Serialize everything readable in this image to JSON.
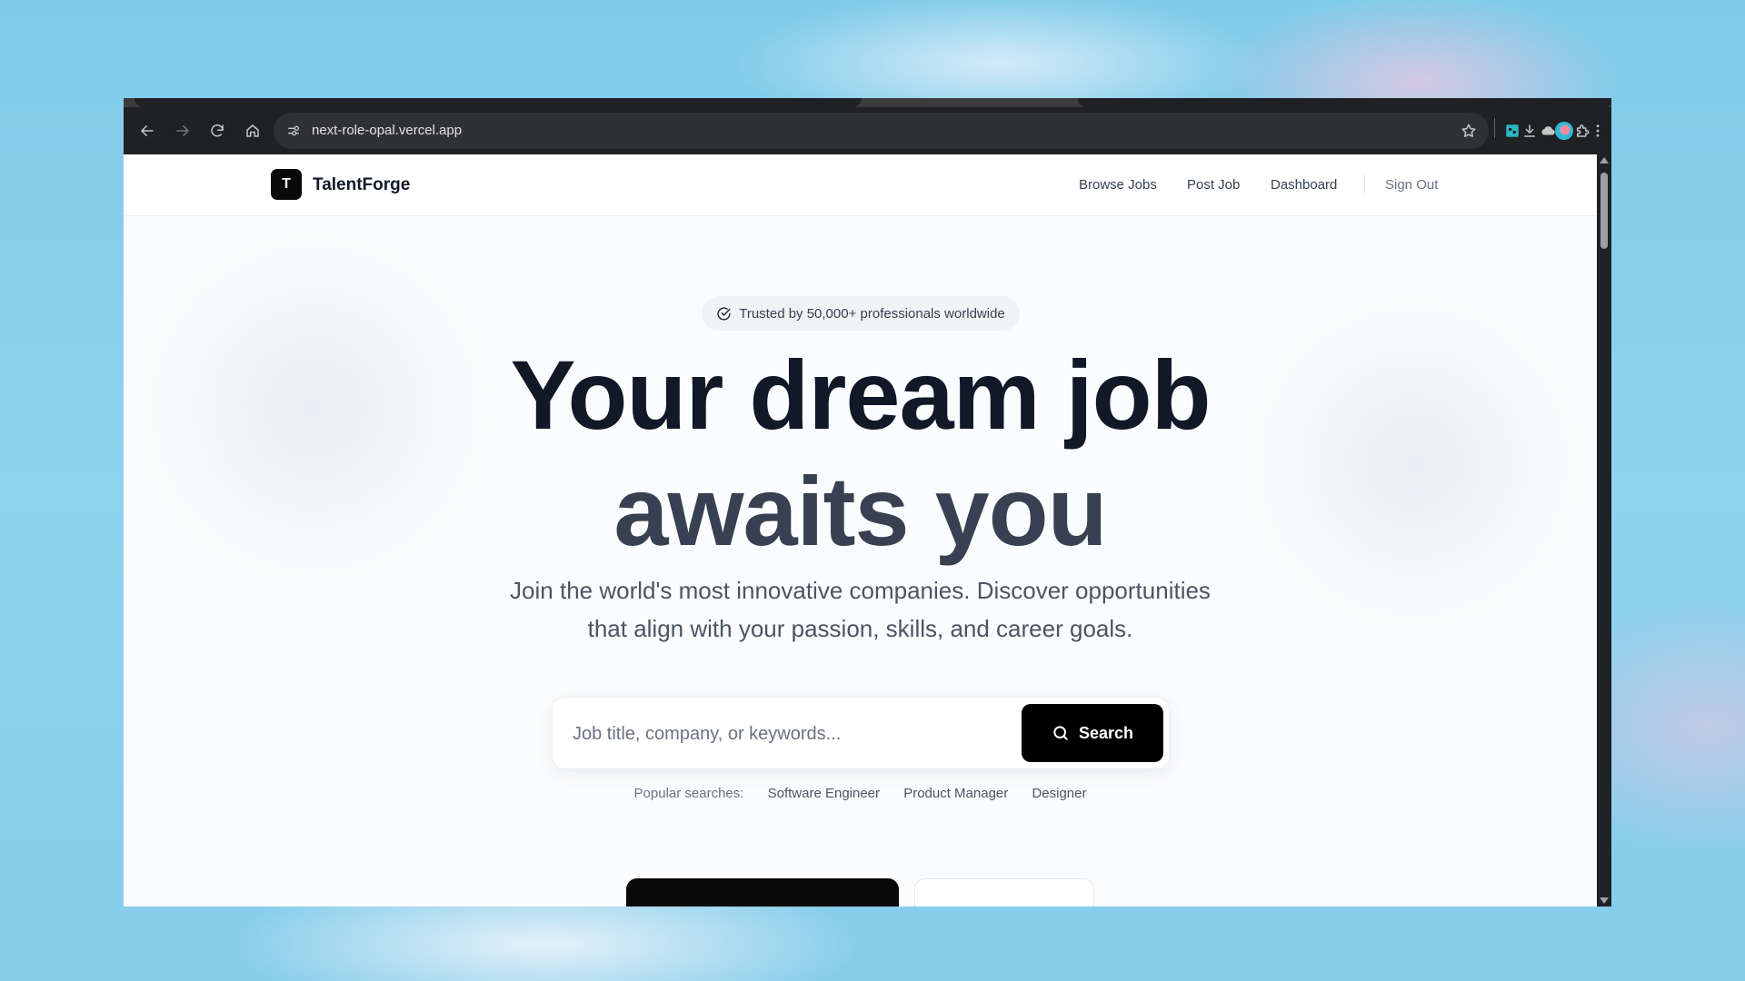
{
  "browser": {
    "url": "next-role-opal.vercel.app",
    "icons": [
      "back-icon",
      "forward-icon",
      "reload-icon",
      "home-icon",
      "site-info-icon",
      "star-icon",
      "extension-icon",
      "cloud-icon",
      "puzzle-icon",
      "download-icon",
      "profile-avatar",
      "more-icon"
    ]
  },
  "header": {
    "logo_letter": "T",
    "brand": "TalentForge",
    "nav": {
      "browse_jobs": "Browse Jobs",
      "post_job": "Post Job",
      "dashboard": "Dashboard",
      "sign_out": "Sign Out"
    }
  },
  "hero": {
    "trust_badge": "Trusted by 50,000+ professionals worldwide",
    "headline_line1": "Your dream job",
    "headline_line2": "awaits you",
    "subtext_line1": "Join the world's most innovative companies. Discover opportunities",
    "subtext_line2": "that align with your passion, skills, and career goals.",
    "search": {
      "placeholder": "Job title, company, or keywords...",
      "button_label": "Search"
    },
    "popular": {
      "label": "Popular searches:",
      "tags": [
        "Software Engineer",
        "Product Manager",
        "Designer"
      ]
    }
  },
  "colors": {
    "primary_button": "#000000",
    "headline_dark": "#111827",
    "headline_secondary": "#374151"
  }
}
